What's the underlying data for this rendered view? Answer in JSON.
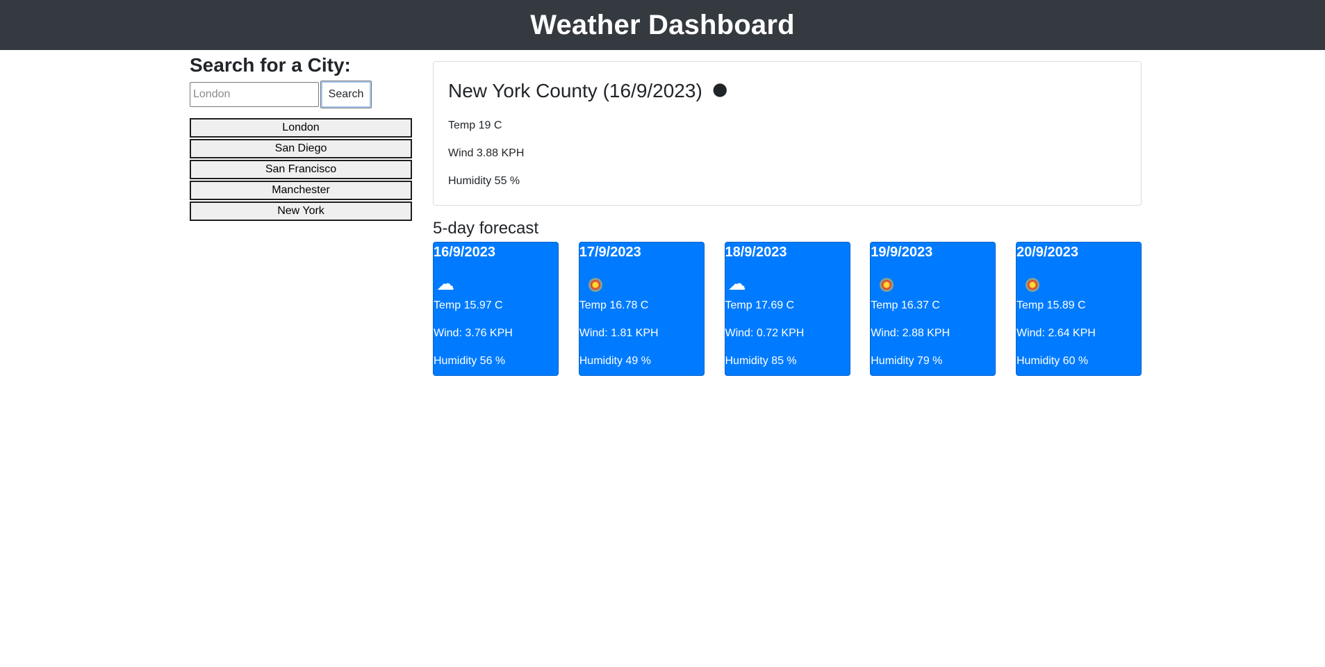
{
  "header": {
    "title": "Weather Dashboard"
  },
  "sidebar": {
    "heading": "Search for a City:",
    "search_placeholder": "London",
    "search_button": "Search",
    "history": [
      "London",
      "San Diego",
      "San Francisco",
      "Manchester",
      "New York"
    ]
  },
  "current": {
    "title": "New York County (16/9/2023)",
    "icon": "🌑",
    "icon_name": "night-clear-icon",
    "temp": "Temp 19 C",
    "wind": "Wind 3.88 KPH",
    "humidity": "Humidity 55 %"
  },
  "forecast": {
    "heading": "5-day forecast",
    "days": [
      {
        "date": "16/9/2023",
        "icon": "☁",
        "icon_name": "cloud-icon",
        "temp": "Temp 15.97 C",
        "wind": "Wind: 3.76 KPH",
        "humidity": "Humidity 56 %"
      },
      {
        "date": "17/9/2023",
        "icon": "sun",
        "icon_name": "sun-icon",
        "temp": "Temp 16.78 C",
        "wind": "Wind: 1.81 KPH",
        "humidity": "Humidity 49 %"
      },
      {
        "date": "18/9/2023",
        "icon": "☁",
        "icon_name": "cloud-icon",
        "temp": "Temp 17.69 C",
        "wind": "Wind: 0.72 KPH",
        "humidity": "Humidity 85 %"
      },
      {
        "date": "19/9/2023",
        "icon": "sun",
        "icon_name": "sun-icon",
        "temp": "Temp 16.37 C",
        "wind": "Wind: 2.88 KPH",
        "humidity": "Humidity 79 %"
      },
      {
        "date": "20/9/2023",
        "icon": "sun",
        "icon_name": "sun-icon",
        "temp": "Temp 15.89 C",
        "wind": "Wind: 2.64 KPH",
        "humidity": "Humidity 60 %"
      }
    ]
  },
  "colors": {
    "header_bg": "#343a40",
    "card_bg": "#007bff"
  }
}
